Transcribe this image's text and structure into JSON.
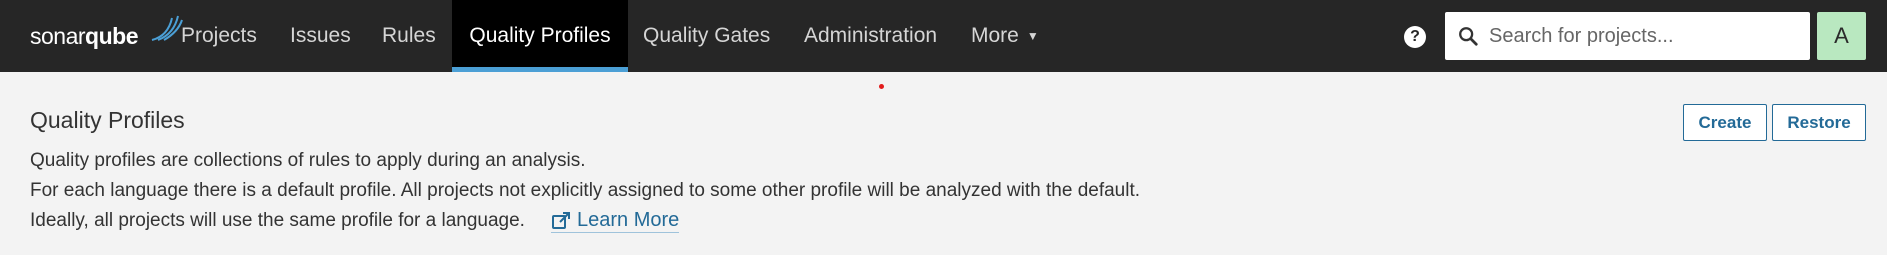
{
  "navbar": {
    "logo_text_regular": "sonar",
    "logo_text_bold": "qube",
    "items": [
      {
        "label": "Projects"
      },
      {
        "label": "Issues"
      },
      {
        "label": "Rules"
      },
      {
        "label": "Quality Profiles",
        "active": true
      },
      {
        "label": "Quality Gates"
      },
      {
        "label": "Administration"
      },
      {
        "label": "More"
      }
    ],
    "help_label": "?",
    "search_placeholder": "Search for projects...",
    "avatar_initial": "A"
  },
  "page": {
    "title": "Quality Profiles",
    "description_lines": [
      "Quality profiles are collections of rules to apply during an analysis.",
      "For each language there is a default profile. All projects not explicitly assigned to some other profile will be analyzed with the default.",
      "Ideally, all projects will use the same profile for a language."
    ],
    "learn_more_label": "Learn More",
    "buttons": {
      "create_label": "Create",
      "restore_label": "Restore"
    }
  },
  "colors": {
    "navbar_bg": "#262626",
    "active_tab_bg": "#000000",
    "active_tab_indicator": "#4b9fd5",
    "link": "#236a97",
    "avatar_bg": "#b9e8c0",
    "page_bg": "#f3f3f3"
  }
}
